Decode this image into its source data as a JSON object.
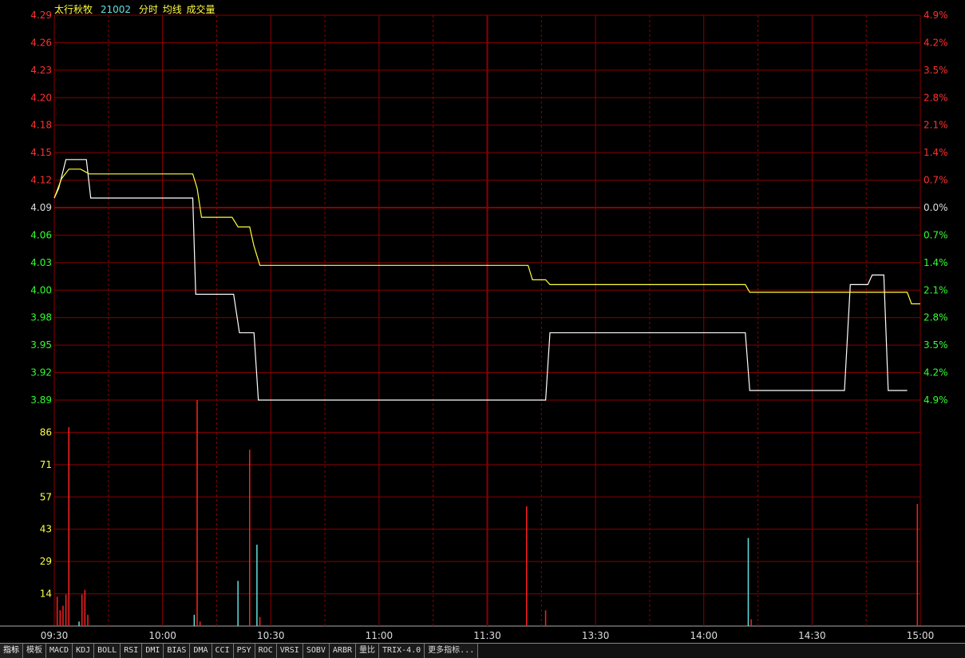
{
  "header": {
    "stock_name": "太行秋牧",
    "stock_code": "21002",
    "items": [
      "分时",
      "均线",
      "成交量"
    ]
  },
  "colors": {
    "grid": "#8b0000",
    "up": "#ff3030",
    "down": "#30ff30",
    "neutral": "#dddddd",
    "price_line": "#ffffff",
    "avg_line": "#ffff40",
    "vol_label": "#ffff40",
    "vol_up": "#ff2020",
    "vol_down": "#60e0e0"
  },
  "chart_data": {
    "type": "line",
    "x_labels": [
      "09:30",
      "10:00",
      "10:30",
      "11:00",
      "11:30",
      "13:30",
      "14:00",
      "14:30",
      "15:00"
    ],
    "prev_close": 4.09,
    "price_ticks_left": [
      "4.29",
      "4.26",
      "4.23",
      "4.20",
      "4.18",
      "4.15",
      "4.12",
      "4.09",
      "4.06",
      "4.03",
      "4.00",
      "3.98",
      "3.95",
      "3.92",
      "3.89"
    ],
    "pct_ticks_right": [
      "4.9%",
      "4.2%",
      "3.5%",
      "2.8%",
      "2.1%",
      "1.4%",
      "0.7%",
      "0.0%",
      "0.7%",
      "1.4%",
      "2.1%",
      "2.8%",
      "3.5%",
      "4.2%",
      "4.9%"
    ],
    "price_range": [
      3.89,
      4.29
    ],
    "volume_ticks": [
      "86",
      "71",
      "57",
      "43",
      "29",
      "14"
    ],
    "volume_range": [
      0,
      100
    ],
    "series": [
      {
        "name": "分时",
        "color": "#ffffff",
        "points": [
          [
            0,
            4.1
          ],
          [
            3,
            4.11
          ],
          [
            8,
            4.14
          ],
          [
            22,
            4.14
          ],
          [
            25,
            4.1
          ],
          [
            95,
            4.1
          ],
          [
            97,
            4.0
          ],
          [
            123,
            4.0
          ],
          [
            127,
            3.96
          ],
          [
            137,
            3.96
          ],
          [
            140,
            3.89
          ],
          [
            337,
            3.89
          ],
          [
            340,
            3.96
          ],
          [
            474,
            3.96
          ],
          [
            477,
            3.9
          ],
          [
            542,
            3.9
          ],
          [
            546,
            4.01
          ],
          [
            558,
            4.01
          ],
          [
            561,
            4.02
          ],
          [
            569,
            4.02
          ],
          [
            572,
            3.9
          ],
          [
            585,
            3.9
          ]
        ]
      },
      {
        "name": "均线",
        "color": "#ffff40",
        "points": [
          [
            0,
            4.1
          ],
          [
            5,
            4.12
          ],
          [
            10,
            4.13
          ],
          [
            18,
            4.13
          ],
          [
            24,
            4.125
          ],
          [
            95,
            4.125
          ],
          [
            98,
            4.11
          ],
          [
            101,
            4.08
          ],
          [
            122,
            4.08
          ],
          [
            126,
            4.07
          ],
          [
            134,
            4.07
          ],
          [
            137,
            4.05
          ],
          [
            141,
            4.03
          ],
          [
            325,
            4.03
          ],
          [
            328,
            4.015
          ],
          [
            337,
            4.015
          ],
          [
            340,
            4.01
          ],
          [
            474,
            4.01
          ],
          [
            477,
            4.002
          ],
          [
            585,
            4.002
          ],
          [
            588,
            3.99
          ],
          [
            594,
            3.99
          ]
        ]
      }
    ],
    "volume": [
      {
        "t": 2,
        "v": 13,
        "c": "up"
      },
      {
        "t": 4,
        "v": 7,
        "c": "up"
      },
      {
        "t": 6,
        "v": 9,
        "c": "up"
      },
      {
        "t": 8,
        "v": 14,
        "c": "up"
      },
      {
        "t": 10,
        "v": 88,
        "c": "up"
      },
      {
        "t": 17,
        "v": 2,
        "c": "down"
      },
      {
        "t": 19,
        "v": 14,
        "c": "up"
      },
      {
        "t": 21,
        "v": 16,
        "c": "up"
      },
      {
        "t": 23,
        "v": 5,
        "c": "up"
      },
      {
        "t": 96,
        "v": 5,
        "c": "down"
      },
      {
        "t": 98,
        "v": 100,
        "c": "up"
      },
      {
        "t": 100,
        "v": 2,
        "c": "up"
      },
      {
        "t": 126,
        "v": 20,
        "c": "down"
      },
      {
        "t": 134,
        "v": 78,
        "c": "up"
      },
      {
        "t": 139,
        "v": 36,
        "c": "down"
      },
      {
        "t": 141,
        "v": 4,
        "c": "up"
      },
      {
        "t": 324,
        "v": 53,
        "c": "up"
      },
      {
        "t": 337,
        "v": 7,
        "c": "up"
      },
      {
        "t": 476,
        "v": 39,
        "c": "down"
      },
      {
        "t": 478,
        "v": 3,
        "c": "up"
      },
      {
        "t": 592,
        "v": 54,
        "c": "up"
      }
    ]
  },
  "tabs": [
    "指标",
    "模板",
    "MACD",
    "KDJ",
    "BOLL",
    "RSI",
    "DMI",
    "BIAS",
    "DMA",
    "CCI",
    "PSY",
    "ROC",
    "VRSI",
    "SOBV",
    "ARBR",
    "量比",
    "TRIX-4.0",
    "更多指标..."
  ]
}
